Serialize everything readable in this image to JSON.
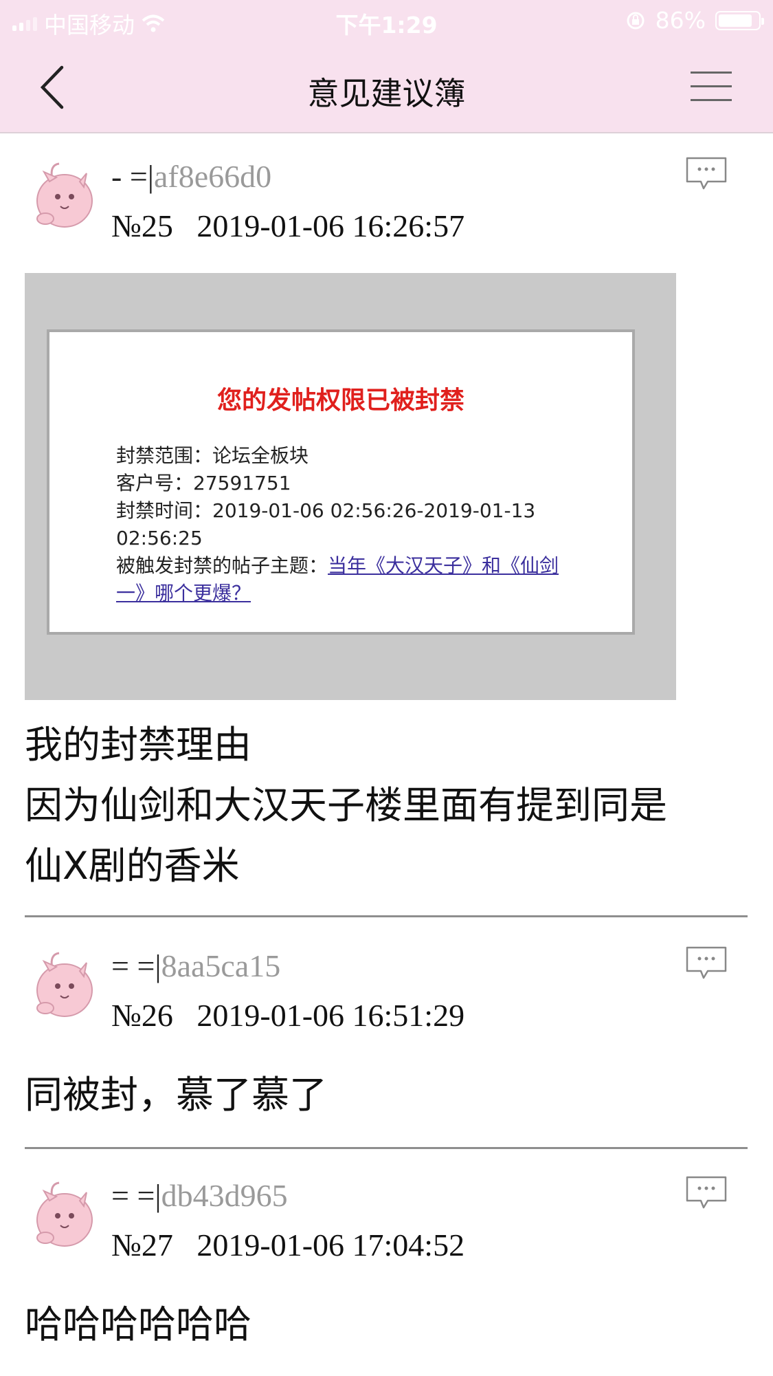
{
  "status_bar": {
    "carrier": "中国移动",
    "time": "下午1:29",
    "battery": "86%",
    "battery_level": 0.86
  },
  "nav": {
    "title": "意见建议簿"
  },
  "posts": [
    {
      "name_prefix": "- =|",
      "user_id": "af8e66d0",
      "number": "№25",
      "datetime": "2019-01-06 16:26:57",
      "image": {
        "warning": "您的发帖权限已被封禁",
        "scope": "封禁范围：论坛全板块",
        "customer": "客户号：27591751",
        "time_line1": "封禁时间：2019-01-06 02:56:26-2019-01-13",
        "time_line2": "02:56:25",
        "trigger_label": "被触发封禁的帖子主题：",
        "trigger_link": "当年《大汉天子》和《仙剑一》哪个更爆？"
      },
      "content_lines": [
        "我的封禁理由",
        "因为仙剑和大汉天子楼里面有提到同是",
        "仙X剧的香米"
      ]
    },
    {
      "name_prefix": "= =|",
      "user_id": "8aa5ca15",
      "number": "№26",
      "datetime": "2019-01-06 16:51:29",
      "content_lines": [
        "同被封，慕了慕了"
      ]
    },
    {
      "name_prefix": "= =|",
      "user_id": "db43d965",
      "number": "№27",
      "datetime": "2019-01-06 17:04:52",
      "content_lines": [
        "哈哈哈哈哈哈"
      ]
    }
  ],
  "colors": {
    "header_bg": "#f8e1ee",
    "warning_red": "#e0201d",
    "link": "#3b2f9d",
    "user_id_gray": "#9a9a9a"
  }
}
